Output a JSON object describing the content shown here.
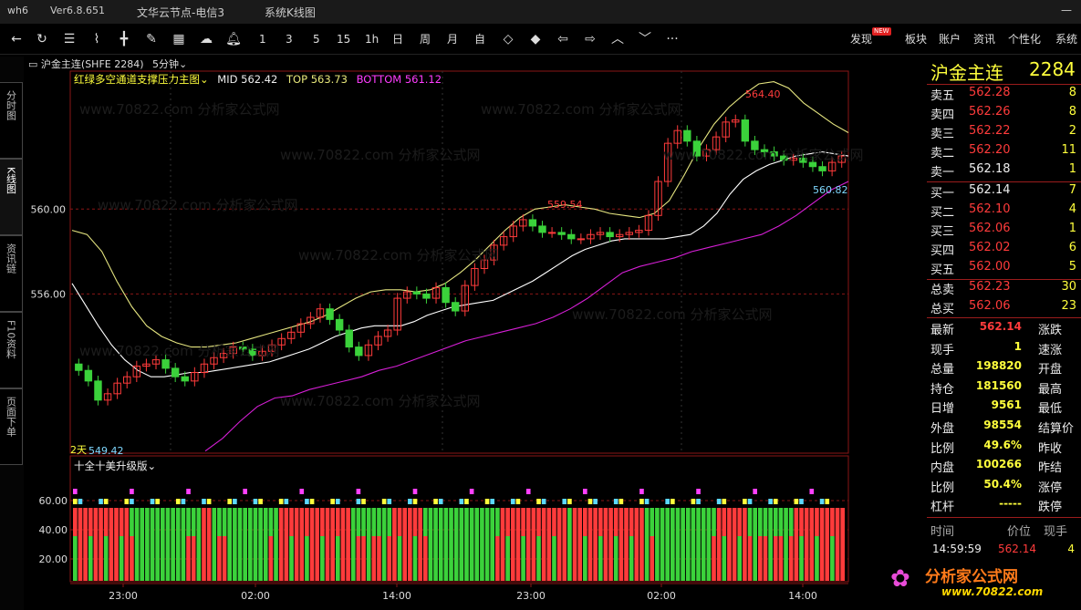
{
  "titlebar": {
    "app": "wh6",
    "version": "Ver6.8.651",
    "server": "文华云节点-电信3",
    "window": "系统K线图"
  },
  "toolbar": {
    "periods": [
      "1",
      "3",
      "5",
      "15",
      "1h",
      "日",
      "周",
      "月",
      "自"
    ],
    "right": {
      "discover": "发现",
      "new_badge": "NEW",
      "sector": "板块",
      "account": "账户",
      "news": "资讯",
      "custom": "个性化",
      "system": "系统"
    }
  },
  "side_tabs": [
    {
      "label": "分时图",
      "active": false
    },
    {
      "label": "K线图",
      "active": true
    },
    {
      "label": "资讯链",
      "active": false
    },
    {
      "label": "F10资料",
      "active": false
    },
    {
      "label": "页面下单",
      "active": false
    }
  ],
  "chart_header": {
    "symbol": "沪金主连(SHFE 2284)",
    "period": "5分钟"
  },
  "indicator": {
    "name": "红绿多空通道支撑压力主图",
    "mid_label": "MID",
    "mid": "562.42",
    "top_label": "TOP",
    "top": "563.73",
    "bottom_label": "BOTTOM",
    "bottom": "561.12"
  },
  "sub_indicator": {
    "name": "十全十美升级版"
  },
  "annotations": {
    "high": "564.40",
    "local_high": "559.54",
    "low": "549.42",
    "days": "2天",
    "last": "560.82"
  },
  "colors": {
    "up": "#ff3b3b",
    "down": "#3bd23b",
    "mid": "#ffffff",
    "top": "#e6e680",
    "bottom": "#d61fd6",
    "accent": "#ff3b3b"
  },
  "chart_data": {
    "type": "candlestick",
    "y_ticks": [
      "560.00",
      "556.00"
    ],
    "sub_y_ticks": [
      "60.00",
      "40.00",
      "20.00"
    ],
    "x_ticks": [
      "23:00",
      "02:00",
      "14:00",
      "23:00",
      "02:00",
      "14:00"
    ],
    "ylim": [
      548.5,
      566.5
    ],
    "close": [
      552.4,
      551.9,
      551.0,
      551.3,
      551.8,
      552.1,
      552.6,
      552.7,
      552.9,
      552.5,
      552.1,
      551.9,
      552.3,
      552.7,
      553.0,
      553.2,
      553.5,
      553.4,
      553.1,
      553.3,
      553.6,
      553.9,
      554.2,
      554.6,
      554.9,
      555.3,
      554.8,
      554.3,
      553.5,
      553.1,
      553.6,
      554.0,
      554.3,
      555.8,
      556.1,
      556.0,
      555.8,
      556.3,
      555.6,
      555.2,
      556.4,
      557.2,
      557.6,
      558.3,
      558.7,
      559.2,
      559.5,
      559.2,
      558.9,
      558.9,
      558.8,
      558.6,
      558.6,
      558.8,
      558.9,
      558.7,
      558.8,
      558.9,
      559.0,
      559.7,
      561.3,
      563.1,
      563.7,
      563.2,
      562.5,
      562.8,
      563.4,
      564.1,
      564.2,
      563.2,
      562.8,
      562.7,
      562.5,
      562.3,
      562.4,
      562.2,
      562.0,
      561.8,
      562.2,
      562.5
    ],
    "mid": [
      556.5,
      555.5,
      554.5,
      553.6,
      552.9,
      552.4,
      552.1,
      552.1,
      552.2,
      552.3,
      552.3,
      552.4,
      552.5,
      552.6,
      552.7,
      552.8,
      553.0,
      553.2,
      553.4,
      553.7,
      554.0,
      554.2,
      554.4,
      554.5,
      554.5,
      554.5,
      554.7,
      555.0,
      555.2,
      555.4,
      555.5,
      555.6,
      555.7,
      556.0,
      556.3,
      556.6,
      557.0,
      557.4,
      557.8,
      558.1,
      558.3,
      558.5,
      558.6,
      558.6,
      558.6,
      558.6,
      558.7,
      558.8,
      559.2,
      559.8,
      560.7,
      561.4,
      561.8,
      562.1,
      562.3,
      562.5,
      562.6,
      562.7,
      562.6,
      562.5
    ],
    "top": [
      559.0,
      558.8,
      558.0,
      556.6,
      555.4,
      554.5,
      554.0,
      553.7,
      553.5,
      553.5,
      553.6,
      553.7,
      553.9,
      554.1,
      554.3,
      554.5,
      554.7,
      555.0,
      555.4,
      555.8,
      556.1,
      556.2,
      556.2,
      556.1,
      556.2,
      556.5,
      557.0,
      557.6,
      558.3,
      559.0,
      559.6,
      560.0,
      560.1,
      560.2,
      560.1,
      560.0,
      559.8,
      559.7,
      559.6,
      559.8,
      560.4,
      561.6,
      562.9,
      564.0,
      564.8,
      565.4,
      565.9,
      566.0,
      565.7,
      565.0,
      564.5,
      564.0,
      563.6
    ],
    "bottom": [
      548.6,
      549.2,
      550.0,
      550.7,
      551.1,
      551.2,
      551.5,
      551.7,
      551.9,
      552.1,
      552.4,
      552.6,
      552.9,
      553.2,
      553.5,
      553.8,
      554.0,
      554.2,
      554.4,
      554.6,
      554.9,
      555.3,
      555.8,
      556.4,
      557.0,
      557.3,
      557.5,
      557.7,
      558.0,
      558.2,
      558.4,
      558.6,
      558.8,
      559.2,
      559.7,
      560.3,
      560.9,
      561.3
    ]
  },
  "quote_panel": {
    "name": "沪金主连",
    "code": "2284",
    "asks": [
      {
        "label": "卖五",
        "price": "562.28",
        "vol": "8"
      },
      {
        "label": "卖四",
        "price": "562.26",
        "vol": "8"
      },
      {
        "label": "卖三",
        "price": "562.22",
        "vol": "2"
      },
      {
        "label": "卖二",
        "price": "562.20",
        "vol": "11"
      },
      {
        "label": "卖一",
        "price": "562.18",
        "vol": "1"
      }
    ],
    "bids": [
      {
        "label": "买一",
        "price": "562.14",
        "vol": "7"
      },
      {
        "label": "买二",
        "price": "562.10",
        "vol": "4"
      },
      {
        "label": "买三",
        "price": "562.06",
        "vol": "1"
      },
      {
        "label": "买四",
        "price": "562.02",
        "vol": "6"
      },
      {
        "label": "买五",
        "price": "562.00",
        "vol": "5"
      }
    ],
    "total_sell_label": "总卖",
    "total_sell_price": "562.23",
    "total_sell_vol": "30",
    "total_buy_label": "总买",
    "total_buy_price": "562.06",
    "total_buy_vol": "23",
    "stats": [
      {
        "label": "最新",
        "value": "562.14",
        "right": "涨跌"
      },
      {
        "label": "现手",
        "value": "1",
        "right": "速涨"
      },
      {
        "label": "总量",
        "value": "198820",
        "right": "开盘"
      },
      {
        "label": "持仓",
        "value": "181560",
        "right": "最高"
      },
      {
        "label": "日增",
        "value": "9561",
        "right": "最低"
      },
      {
        "label": "外盘",
        "value": "98554",
        "right": "结算价"
      },
      {
        "label": "比例",
        "value": "49.6%",
        "right": "昨收"
      },
      {
        "label": "内盘",
        "value": "100266",
        "right": "昨结"
      },
      {
        "label": "比例",
        "value": "50.4%",
        "right": "涨停"
      },
      {
        "label": "杠杆",
        "value": "-----",
        "right": "跌停"
      }
    ],
    "ticks_header": {
      "time": "时间",
      "price": "价位",
      "vol": "现手"
    },
    "tick": {
      "time": "14:59:59",
      "price": "562.14",
      "vol": "4"
    }
  },
  "watermark": {
    "text": "www.70822.com 分析家公式网",
    "logo": "分析家公式网",
    "logo_url": "www.70822.com"
  }
}
